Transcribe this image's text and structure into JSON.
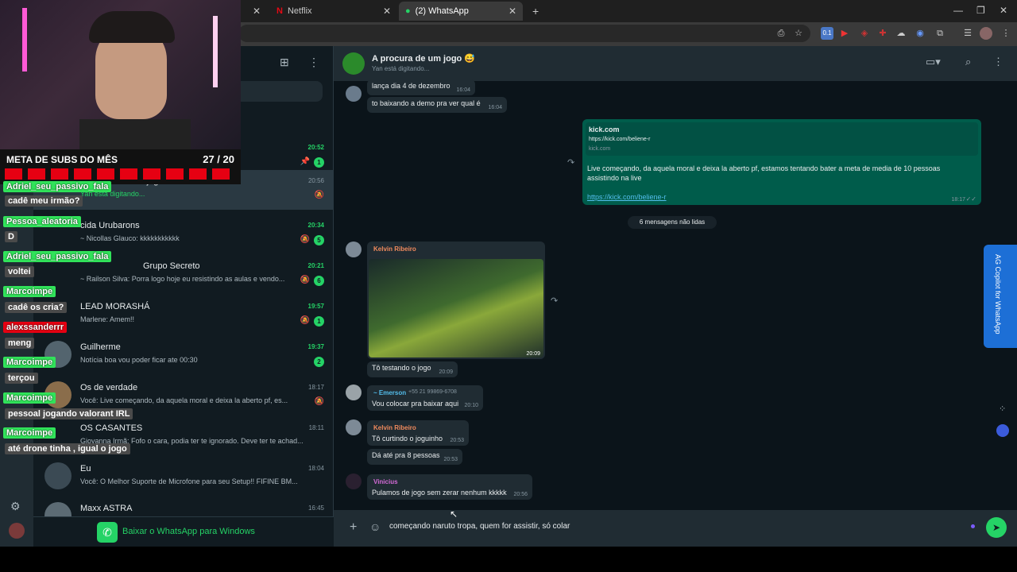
{
  "browser": {
    "tabs": [
      {
        "title": "Netflix"
      },
      {
        "title": "(2) WhatsApp"
      }
    ]
  },
  "sidebar": {
    "chats": [
      {
        "name": "",
        "msg": "",
        "time": "20:52",
        "badge": "1"
      },
      {
        "name": "A procura de um jogo",
        "msg": "Yan está digitando...",
        "time": "20:56"
      },
      {
        "name": "cida Urubarons",
        "msg": "~ Nicollas Glauco: kkkkkkkkkkk",
        "time": "20:34",
        "badge": "5"
      },
      {
        "name": "Grupo Secreto",
        "msg": "~ Railson Silva: Porra logo hoje eu resistindo as aulas e vendo...",
        "time": "20:21",
        "badge": "6"
      },
      {
        "name": "LEAD  MORASHÁ",
        "msg": "Marlene: Amem!!",
        "time": "19:57",
        "badge": "1"
      },
      {
        "name": "Guilherme",
        "msg": "Notícia boa vou poder ficar ate 00:30",
        "time": "19:37",
        "badge": "2"
      },
      {
        "name": "Os de verdade",
        "msg": "Você: Live começando, da aquela moral e deixa la aberto pf, es...",
        "time": "18:17"
      },
      {
        "name": "OS CASANTES",
        "msg": "Giovanna Irmã: Fofo o cara, podia ter te ignorado. Deve ter te achad...",
        "time": "18:11"
      },
      {
        "name": "Eu",
        "msg": "Você: O Melhor Suporte de Microfone para seu Setup!! FIFINE BM...",
        "time": "18:04"
      },
      {
        "name": "Maxx ASTRA",
        "msg": "",
        "time": "16:45"
      }
    ],
    "download_label": "Baixar o WhatsApp para Windows"
  },
  "chat": {
    "title": "A procura de um jogo 😅",
    "subtitle": "Yan está digitando...",
    "messages": {
      "m1": {
        "text": "lança dia 4 de dezembro",
        "time": "16:04"
      },
      "m2": {
        "text": "to baixando a demo pra ver qual é",
        "time": "16:04"
      },
      "link_title": "kick.com",
      "link_url_small": "https://kick.com/beliene-r",
      "link_domain": "kick.com",
      "out_text": "Live começando, da aquela moral e deixa la aberto pf, estamos tentando bater a meta de media de 10 pessoas assistindo na live",
      "out_link": "https://kick.com/beliene-r",
      "out_time": "18:17",
      "unread": "6 mensagens não lidas",
      "kelvin_name": "Kelvin Ribeiro",
      "img_time": "20:09",
      "m3": {
        "text": "Tô testando o jogo",
        "time": "20:09"
      },
      "emerson_name": "~ Emerson",
      "emerson_phone": "+55 21 99869-6708",
      "m4": {
        "text": "Vou colocar pra baixar aqui",
        "time": "20:10"
      },
      "m5": {
        "text": "Tô curtindo o joguinho",
        "time": "20:53"
      },
      "m6": {
        "text": "Dá até pra 8 pessoas",
        "time": "20:53"
      },
      "vinicius_name": "Vinicius",
      "m7": {
        "text": "Pulamos de jogo sem zerar nenhum kkkkk",
        "time": "20:56"
      }
    },
    "composer_text": "começando naruto tropa, quem for assistir, só colar"
  },
  "overlay": {
    "meta_title": "META DE SUBS DO MÊS",
    "meta_count": "27 / 20",
    "meta_progress": 1.0,
    "chat": [
      {
        "user": "Adriel_seu_passivo_fala",
        "msg": "cadê meu irmão?"
      },
      {
        "user": "Pessoa_aleatoria",
        "msg": "D"
      },
      {
        "user": "Adriel_seu_passivo_fala",
        "msg": "voltei"
      },
      {
        "user": "Marcoimpe",
        "msg": "cadê os cria?"
      },
      {
        "user": "alexssanderrr",
        "msg": "meng"
      },
      {
        "user": "Marcoimpe",
        "msg": "terçou"
      },
      {
        "user": "Marcoimpe",
        "msg": "pessoal jogando valorant IRL"
      },
      {
        "user": "Marcoimpe",
        "msg": "até drone tinha , igual o jogo"
      }
    ]
  },
  "extension": {
    "label": "AG Copilot for WhatsApp"
  },
  "colors": {
    "whatsapp_green": "#25d366",
    "outgoing_bubble": "#005c4b",
    "kick_green": "#31e35a",
    "meta_red": "#e60012"
  }
}
